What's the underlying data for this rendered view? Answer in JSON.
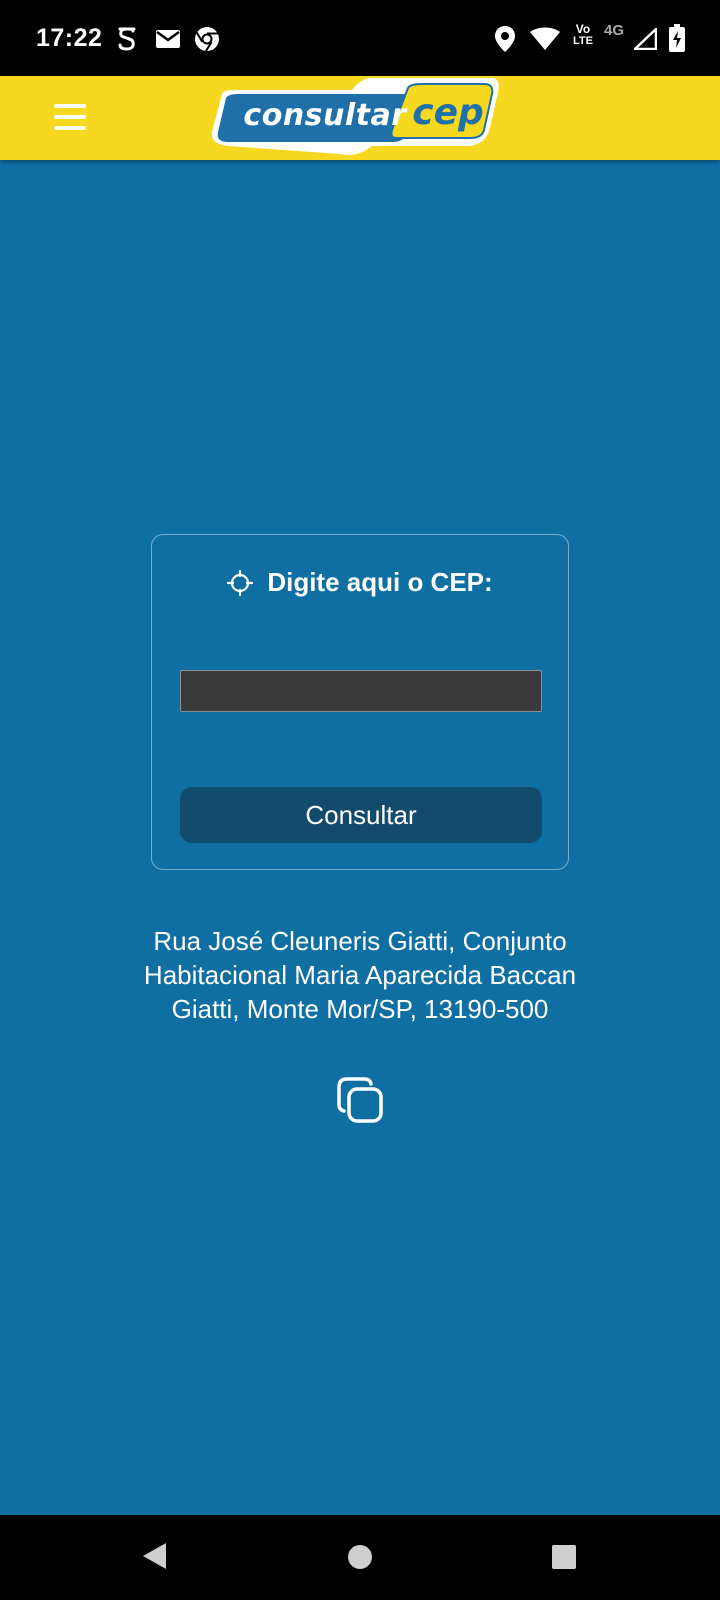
{
  "status_bar": {
    "time": "17:22",
    "volte_top": "Vo",
    "volte_bottom": "LTE",
    "network": "4G",
    "icons": [
      "s-notification-icon",
      "mail-icon",
      "chrome-icon",
      "location-icon",
      "wifi-icon",
      "volte-icon",
      "signal-icon",
      "battery-charging-icon"
    ]
  },
  "app_bar": {
    "menu_icon": "hamburger-menu-icon",
    "logo_part1": "consultar",
    "logo_part2": "cep"
  },
  "card": {
    "title": "Digite aqui o CEP:",
    "title_icon": "crosshair-icon",
    "input_value": "",
    "button_label": "Consultar"
  },
  "result": {
    "address": "Rua José Cleuneris Giatti, Conjunto Habitacional Maria Aparecida Baccan Giatti, Monte Mor/SP, 13190-500",
    "copy_icon": "copy-icon"
  },
  "nav_bar": {
    "icons": [
      "back-icon",
      "home-icon",
      "recents-icon"
    ]
  },
  "colors": {
    "background": "#0f6fa3",
    "app_bar": "#f6d81f",
    "button": "#134b6c",
    "input": "#3a3a3b"
  }
}
